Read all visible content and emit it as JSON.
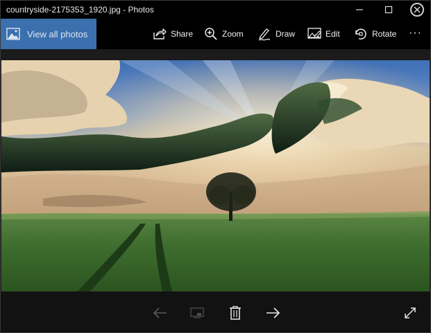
{
  "window": {
    "title": "countryside-2175353_1920.jpg - Photos"
  },
  "titlebar_buttons": {
    "minimize_icon": "minimize-icon",
    "maximize_icon": "maximize-icon",
    "close_icon": "close-icon"
  },
  "toolbar": {
    "view_all_label": "View all photos",
    "share_label": "Share",
    "zoom_label": "Zoom",
    "draw_label": "Draw",
    "edit_label": "Edit",
    "rotate_label": "Rotate",
    "more_label": "···"
  },
  "bottombar": {
    "previous_icon": "arrow-left-icon",
    "slideshow_icon": "slideshow-icon",
    "delete_icon": "trash-icon",
    "next_icon": "arrow-right-icon",
    "fullscreen_icon": "fullscreen-icon"
  },
  "colors": {
    "accent": "#3b6fae",
    "toolbar_bg": "#000000",
    "bottombar_bg": "#121212"
  }
}
